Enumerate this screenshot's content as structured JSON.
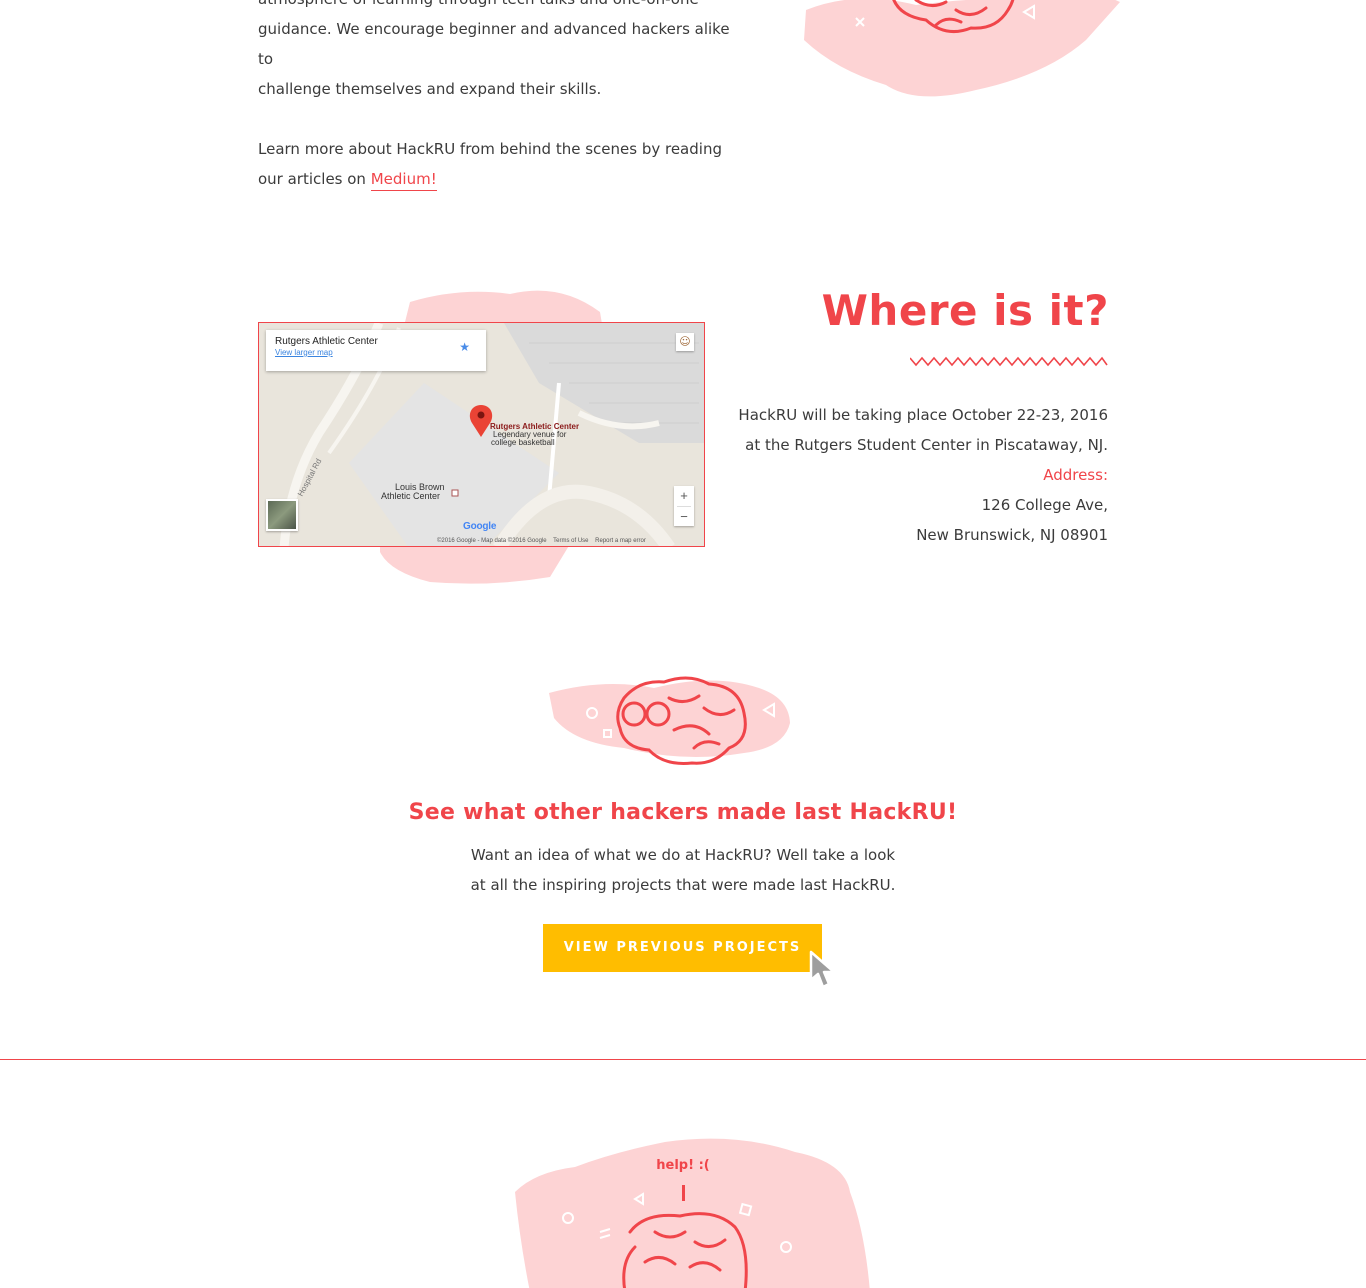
{
  "about": {
    "para1_lines": [
      "atmosphere of learning through tech talks and one-on-one",
      "guidance. We encourage beginner and advanced hackers alike to",
      "challenge themselves and expand their skills."
    ],
    "para2_prefix": "Learn more about HackRU from behind the scenes by reading our articles on ",
    "medium_link": "Medium!"
  },
  "map": {
    "place_name": "Rutgers Athletic Center",
    "view_larger": "View larger map",
    "marker_title": "Rutgers Athletic Center",
    "marker_sub1": "Legendary venue for",
    "marker_sub2": "college basketball",
    "building_label1": "Louis Brown",
    "building_label2": "Athletic Center",
    "road_label": "Hospital Rd",
    "google_logo": "Google",
    "footer_data": "©2016 Google - Map data ©2016 Google",
    "footer_terms": "Terms of Use",
    "footer_report": "Report a map error",
    "zoom_in": "+",
    "zoom_out": "−"
  },
  "where": {
    "title": "Where is it?",
    "line1": "HackRU will be taking place October 22-23, 2016",
    "line2": "at the Rutgers Student Center in Piscataway, NJ.",
    "address_label": "Address:",
    "address_line1": "126 College Ave,",
    "address_line2": "New Brunswick, NJ 08901"
  },
  "projects": {
    "title": "See what other hackers made last HackRU!",
    "desc_line1": "Want an idea of what we do at HackRU? Well take a look",
    "desc_line2": "at all the inspiring projects that were made last HackRU.",
    "button_label": "VIEW PREVIOUS PROJECTS"
  },
  "help": {
    "text": "help! :("
  },
  "colors": {
    "accent": "#f0454a",
    "splat": "#fdd3d4",
    "button": "#ffbd00",
    "body_text": "#3b3b3b"
  }
}
